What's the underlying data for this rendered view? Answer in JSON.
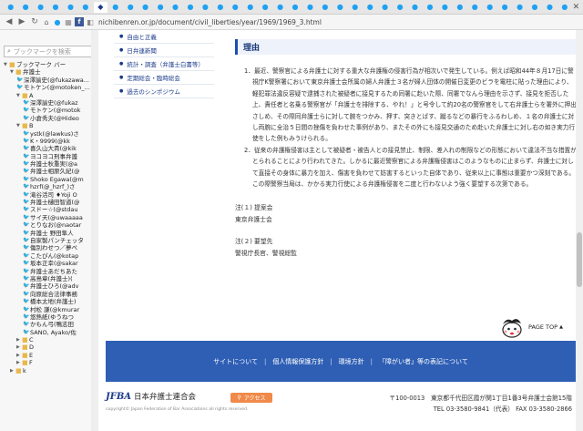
{
  "browser": {
    "tabs_count": 38,
    "url": "nichibenren.or.jp/document/civil_liberties/year/1969/1969_3.html"
  },
  "sidebar": {
    "search_placeholder": "ブックマークを検索",
    "items": [
      {
        "type": "folder",
        "label": "ブックマーク バー",
        "indent": 0,
        "open": true
      },
      {
        "type": "folder",
        "label": "弁護士",
        "indent": 1,
        "open": true
      },
      {
        "type": "tw",
        "label": "深澤諭史(@fukazawa...",
        "indent": 2
      },
      {
        "type": "tw",
        "label": "モトケン(@motoken_...",
        "indent": 2
      },
      {
        "type": "folder",
        "label": "A",
        "indent": 2,
        "open": true
      },
      {
        "type": "tw",
        "label": "深澤諭史(@fukaz",
        "indent": 3
      },
      {
        "type": "tw",
        "label": "モトケン(@motok",
        "indent": 3
      },
      {
        "type": "tw",
        "label": "小倉秀夫(@Hideo",
        "indent": 3
      },
      {
        "type": "folder",
        "label": "B",
        "indent": 2,
        "open": true
      },
      {
        "type": "tw",
        "label": "ystk(@lawkus)さ",
        "indent": 3
      },
      {
        "type": "tw",
        "label": "K・9999(@kk",
        "indent": 3
      },
      {
        "type": "tw",
        "label": "喜久山大貴(@kik",
        "indent": 3
      },
      {
        "type": "tw",
        "label": "ヨコヨコ刑事弁護",
        "indent": 3
      },
      {
        "type": "tw",
        "label": "弁護士秋重実(@a",
        "indent": 3
      },
      {
        "type": "tw",
        "label": "弁護士相原久紀(@",
        "indent": 3
      },
      {
        "type": "tw",
        "label": "Shoko Egawa(@m",
        "indent": 3
      },
      {
        "type": "tw",
        "label": "hzrf(@_hzrf_)さ",
        "indent": 3
      },
      {
        "type": "tw",
        "label": "滝谷活司 ♦Yoji O",
        "indent": 3
      },
      {
        "type": "tw",
        "label": "弁護士樋田智道(@",
        "indent": 3
      },
      {
        "type": "tw",
        "label": "スドー☆(@stdau",
        "indent": 3
      },
      {
        "type": "tw",
        "label": "サイ天(@uwaaaaa",
        "indent": 3
      },
      {
        "type": "tw",
        "label": "とりなお(@naotar",
        "indent": 3
      },
      {
        "type": "tw",
        "label": "弁護士 野田隼人",
        "indent": 3
      },
      {
        "type": "tw",
        "label": "自家製パンチェッタ",
        "indent": 3
      },
      {
        "type": "tw",
        "label": "傷別わせつ／夢ぺ",
        "indent": 3
      },
      {
        "type": "tw",
        "label": "こたぴん(@kotap",
        "indent": 3
      },
      {
        "type": "tw",
        "label": "坂本正幸(@sakar",
        "indent": 3
      },
      {
        "type": "tw",
        "label": "弁護士あだちあた",
        "indent": 3
      },
      {
        "type": "tw",
        "label": "高島章(弁護士)(",
        "indent": 3
      },
      {
        "type": "tw",
        "label": "弁護士ひろ(@adv",
        "indent": 3
      },
      {
        "type": "tw",
        "label": "向原総合法律事務",
        "indent": 3
      },
      {
        "type": "tw",
        "label": "橋本太地(弁護士)",
        "indent": 3
      },
      {
        "type": "tw",
        "label": "村松 謙(@kmurar",
        "indent": 3
      },
      {
        "type": "tw",
        "label": "悠熱紙(ゆうねつ",
        "indent": 3
      },
      {
        "type": "tw",
        "label": "かもん弓(鴨志田",
        "indent": 3
      },
      {
        "type": "tw",
        "label": "SANO, Ayako/佐",
        "indent": 3
      },
      {
        "type": "folder",
        "label": "C",
        "indent": 2,
        "open": false
      },
      {
        "type": "folder",
        "label": "D",
        "indent": 2,
        "open": false
      },
      {
        "type": "folder",
        "label": "E",
        "indent": 2,
        "open": false
      },
      {
        "type": "folder",
        "label": "F",
        "indent": 2,
        "open": false
      },
      {
        "type": "folder",
        "label": "k",
        "indent": 1,
        "open": false
      }
    ]
  },
  "leftnav": [
    "自由と正義",
    "日弁連新聞",
    "統計・調査（弁護士白書等）",
    "定期総会・臨時総会",
    "過去のシンポジウム"
  ],
  "article": {
    "heading": "理由",
    "reasons": [
      "1．最近、警察官による弁護士に対する重大な弁護権の侵害行為が相次いで発生している。例えば昭和44年８月17日に警視庁K警察署において東京弁護士会所属の婦人弁護士３名が婦人団体の開催日変更のビラを電柱に貼った理由により、軽犯罪法違反容疑で逮捕された被疑者に接見するため同署に赴いた際、同署でなんら理由を示さず、接見を拒否した上、責任者と名乗る警察官が「弁護士を排除する、やれ！」と号令して約20名の警察官をして右弁護士らを署外に押出さしめ、その際同弁護士らに対して腕をつかみ、押す、突きとばす、蹴るなどの暴行をふるわしめ、１名の弁護士に対し両腕に全治５日間の挫傷を負わせた事例があり、またその外にも接見交通のため赴いた弁護士に対し右の如き実力行使をした例もみうけられる。",
      "2．従来の弁護権侵害は主として被疑者・被告人との接見禁止、制限、差入れの制限などの形態において違法不当な措置がとられることにより行われてきた。しかるに最近警察官による弁護権侵害はこのようなものに止まらず、弁護士に対して直接その身体に暴力を加え、傷害を負わせて妨害するといった自体であり、従来以上に事態は重要かつ深刻である。この際警察当局は、かかる実力行使による弁護権侵害を二度と行わないよう強く要望する次第である。"
    ],
    "notes": [
      {
        "title": "注(１) 提案会",
        "value": "東京弁護士会"
      },
      {
        "title": "注(２) 要望先",
        "value": "警視庁長官、警視総監"
      }
    ]
  },
  "pagetop_label": "PAGE TOP",
  "footer": {
    "links": [
      "サイトについて",
      "個人情報保護方針",
      "環境方針",
      "「障がい者」等の表記について"
    ],
    "logo_mark": "JFBA",
    "org_name": "日本弁護士連合会",
    "access_label": "アクセス",
    "copyright": "copyright© Japan Federation of Bar Associations all rights reserved.",
    "address": "〒100-0013　東京都千代田区霞が関1丁目1番3号弁護士会館15階",
    "phone": "TEL 03-3580-9841（代表） FAX 03-3580-2866"
  },
  "colors": {
    "footer_band": "#2f5fb5",
    "accent": "#1a4fb3",
    "access": "#f08a4b"
  }
}
